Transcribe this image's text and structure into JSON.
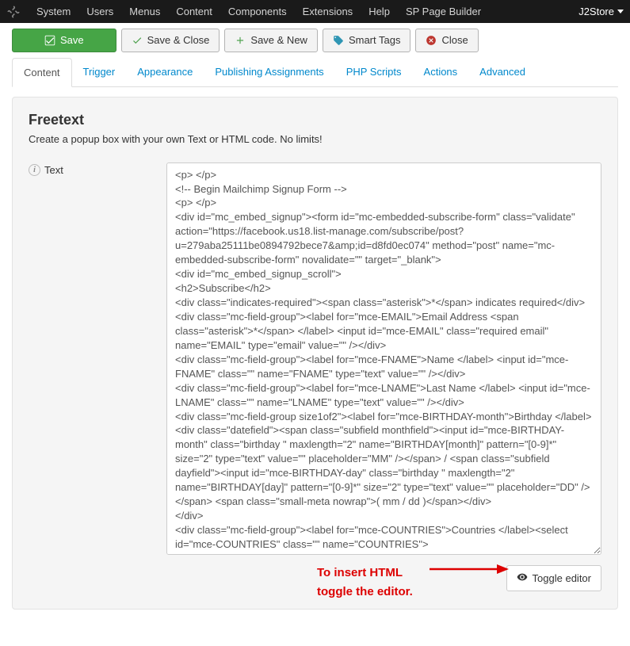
{
  "topbar": {
    "menus": [
      "System",
      "Users",
      "Menus",
      "Content",
      "Components",
      "Extensions",
      "Help",
      "SP Page Builder"
    ],
    "brand": "J2Store"
  },
  "toolbar": {
    "save": "Save",
    "save_close": "Save & Close",
    "save_new": "Save & New",
    "smart_tags": "Smart Tags",
    "close": "Close"
  },
  "tabs": [
    {
      "label": "Content",
      "active": true
    },
    {
      "label": "Trigger",
      "active": false
    },
    {
      "label": "Appearance",
      "active": false
    },
    {
      "label": "Publishing Assignments",
      "active": false
    },
    {
      "label": "PHP Scripts",
      "active": false
    },
    {
      "label": "Actions",
      "active": false
    },
    {
      "label": "Advanced",
      "active": false
    }
  ],
  "panel": {
    "title": "Freetext",
    "description": "Create a popup box with your own Text or HTML code. No limits!",
    "field_label": "Text",
    "editor_value": "<p> </p>\n<!-- Begin Mailchimp Signup Form -->\n<p> </p>\n<div id=\"mc_embed_signup\"><form id=\"mc-embedded-subscribe-form\" class=\"validate\" action=\"https://facebook.us18.list-manage.com/subscribe/post?u=279aba25111be0894792bece7&amp;id=d8fd0ec074\" method=\"post\" name=\"mc-embedded-subscribe-form\" novalidate=\"\" target=\"_blank\">\n<div id=\"mc_embed_signup_scroll\">\n<h2>Subscribe</h2>\n<div class=\"indicates-required\"><span class=\"asterisk\">*</span> indicates required</div>\n<div class=\"mc-field-group\"><label for=\"mce-EMAIL\">Email Address <span class=\"asterisk\">*</span> </label> <input id=\"mce-EMAIL\" class=\"required email\" name=\"EMAIL\" type=\"email\" value=\"\" /></div>\n<div class=\"mc-field-group\"><label for=\"mce-FNAME\">Name </label> <input id=\"mce-FNAME\" class=\"\" name=\"FNAME\" type=\"text\" value=\"\" /></div>\n<div class=\"mc-field-group\"><label for=\"mce-LNAME\">Last Name </label> <input id=\"mce-LNAME\" class=\"\" name=\"LNAME\" type=\"text\" value=\"\" /></div>\n<div class=\"mc-field-group size1of2\"><label for=\"mce-BIRTHDAY-month\">Birthday </label>\n<div class=\"datefield\"><span class=\"subfield monthfield\"><input id=\"mce-BIRTHDAY-month\" class=\"birthday \" maxlength=\"2\" name=\"BIRTHDAY[month]\" pattern=\"[0-9]*\" size=\"2\" type=\"text\" value=\"\" placeholder=\"MM\" /></span> / <span class=\"subfield dayfield\"><input id=\"mce-BIRTHDAY-day\" class=\"birthday \" maxlength=\"2\" name=\"BIRTHDAY[day]\" pattern=\"[0-9]*\" size=\"2\" type=\"text\" value=\"\" placeholder=\"DD\" /></span> <span class=\"small-meta nowrap\">( mm / dd )</span></div>\n</div>\n<div class=\"mc-field-group\"><label for=\"mce-COUNTRIES\">Countries </label><select id=\"mce-COUNTRIES\" class=\"\" name=\"COUNTRIES\">",
    "toggle_editor": "Toggle editor"
  },
  "callout": {
    "line1": "To insert HTML",
    "line2": "toggle the editor."
  }
}
